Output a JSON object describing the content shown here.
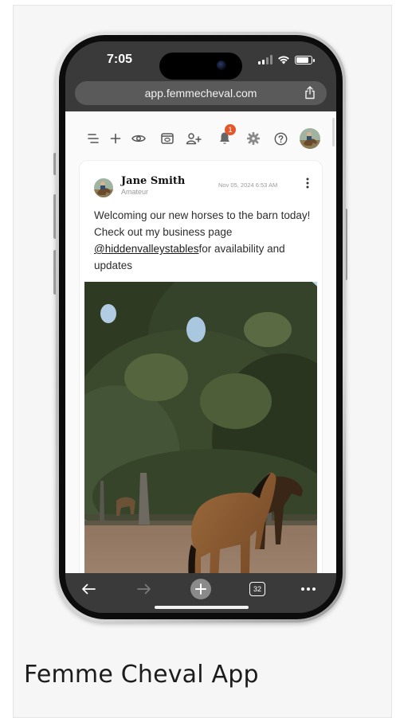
{
  "caption": "Femme Cheval App",
  "status_bar": {
    "time": "7:05"
  },
  "browser": {
    "url": "app.femmecheval.com",
    "tab_count": "32"
  },
  "toolbar": {
    "notification_count": "1"
  },
  "post": {
    "author_name": "Jane Smith",
    "author_role": "Amateur",
    "date": "Nov 05, 2024 6:53 AM",
    "text_before": "Welcoming our new horses to the barn today! Check out my business page ",
    "mention": "@hiddenvalleystables",
    "text_after": "for availability and updates"
  },
  "colors": {
    "badge": "#e2572b",
    "browser_chrome": "#3a3a3a",
    "page_background": "#fafafa"
  }
}
